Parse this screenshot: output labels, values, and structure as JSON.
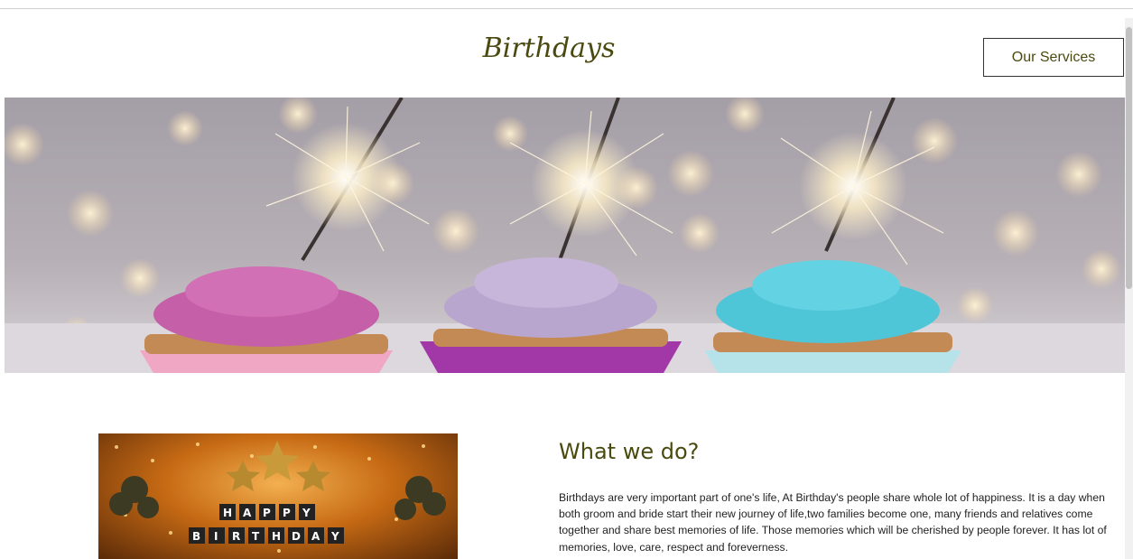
{
  "header": {
    "brand": "Birthdays",
    "services_button": "Our Services"
  },
  "hero": {
    "image": "birthday-cupcakes-with-sparklers-image",
    "cupcake_frosting_colors": [
      "#c45fa8",
      "#b9a6cf",
      "#4fc6d8"
    ]
  },
  "about": {
    "image": "happy-birthday-party-decoration-image",
    "banner_letters": [
      "H",
      "A",
      "P",
      "P",
      "Y",
      "B",
      "I",
      "R",
      "T",
      "H",
      "D",
      "A",
      "Y"
    ],
    "title": "What we do?",
    "body": "Birthdays are very important part of one's life, At Birthday's people share whole lot of happiness. It is a day when both groom and bride start their new journey of life,two families become one, many friends and relatives come together and share best memories of life. Those memories which will be cherished by people forever. It has lot of memories, love, care, respect and foreverness."
  },
  "colors": {
    "accent": "#4a4a10"
  }
}
